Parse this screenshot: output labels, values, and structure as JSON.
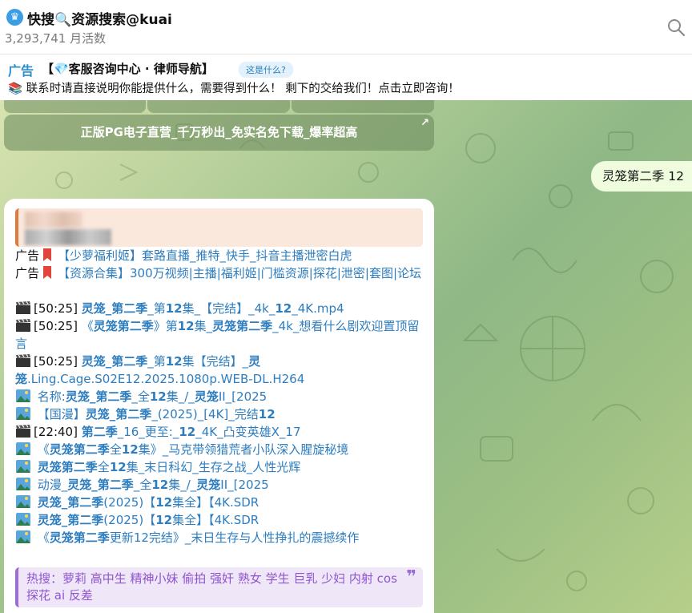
{
  "header": {
    "title": "快搜🔍资源搜索@kuai",
    "subtitle": "3,293,741 月活数"
  },
  "ad_bar": {
    "tag": "广告",
    "title": "【💎客服咨询中心 · 律师导航】",
    "whatis": "这是什么?",
    "description": "📚 联系时请直接说明你能提供什么，需要得到什么！ 剩下的交给我们！点击立即咨询！"
  },
  "keyboard": {
    "button_label": "正版PG电子直营_千万秒出_免实名免下载_爆率超高",
    "arrow": "↗"
  },
  "outgoing": {
    "text": "灵笼第二季 12"
  },
  "incoming": {
    "ad_label": "广告",
    "ad1": "【少萝福利姬】套路直播_推特_快手_抖音主播泄密白虎",
    "ad2": "【资源合集】300万视频|主播|福利姬|门槛资源|探花|泄密|套图|论坛",
    "results": [
      {
        "icon": "clapper-icon",
        "prefix": "[50:25] ",
        "parts": [
          [
            "灵笼_第二季",
            1
          ],
          [
            "_第",
            0
          ],
          [
            "12",
            1
          ],
          [
            "集_【完结】_4k_",
            0
          ],
          [
            "12",
            1
          ],
          [
            "_4K.mp4",
            0
          ]
        ]
      },
      {
        "icon": "clapper-icon",
        "prefix": "[50:25] ",
        "parts": [
          [
            "《",
            0
          ],
          [
            "灵笼第二季",
            1
          ],
          [
            "》第",
            0
          ],
          [
            "12",
            1
          ],
          [
            "集_",
            0
          ],
          [
            "灵笼第二季",
            1
          ],
          [
            "_4k_想看什么剧欢迎置顶留言",
            0
          ]
        ]
      },
      {
        "icon": "clapper-icon",
        "prefix": "[50:25] ",
        "parts": [
          [
            "灵笼_第二季",
            1
          ],
          [
            "_第",
            0
          ],
          [
            "12",
            1
          ],
          [
            "集【完结】_",
            0
          ],
          [
            "灵笼",
            1
          ],
          [
            ".Ling.Cage.S02E12.2025.1080p.WEB-DL.H264",
            0
          ]
        ]
      },
      {
        "icon": "picture-icon",
        "prefix": " ",
        "parts": [
          [
            "名称:",
            0
          ],
          [
            "灵笼_第二季",
            1
          ],
          [
            "_全",
            0
          ],
          [
            "12",
            1
          ],
          [
            "集_/_",
            0
          ],
          [
            "灵笼",
            1
          ],
          [
            "II_[2025",
            0
          ]
        ]
      },
      {
        "icon": "picture-icon",
        "prefix": " ",
        "parts": [
          [
            "【国漫】",
            0
          ],
          [
            "灵笼_第二季",
            1
          ],
          [
            "_(2025)_[4K]_完结",
            0
          ],
          [
            "12",
            1
          ]
        ]
      },
      {
        "icon": "clapper-icon",
        "prefix": "[22:40] ",
        "parts": [
          [
            "第二季",
            1
          ],
          [
            "_16_更至:_",
            0
          ],
          [
            "12",
            1
          ],
          [
            "_4K_凸变英雄X_17",
            0
          ]
        ]
      },
      {
        "icon": "picture-icon",
        "prefix": " ",
        "parts": [
          [
            "《",
            0
          ],
          [
            "灵笼第二季",
            1
          ],
          [
            "全",
            0
          ],
          [
            "12",
            1
          ],
          [
            "集》_马克带领猎荒者小队深入腥旋秘境",
            0
          ]
        ]
      },
      {
        "icon": "picture-icon",
        "prefix": " ",
        "parts": [
          [
            "灵笼第二季",
            1
          ],
          [
            "全",
            0
          ],
          [
            "12",
            1
          ],
          [
            "集_末日科幻_生存之战_人性光辉",
            0
          ]
        ]
      },
      {
        "icon": "picture-icon",
        "prefix": " ",
        "parts": [
          [
            "动漫_",
            0
          ],
          [
            "灵笼_第二季",
            1
          ],
          [
            "_全",
            0
          ],
          [
            "12",
            1
          ],
          [
            "集_/_",
            0
          ],
          [
            "灵笼",
            1
          ],
          [
            "II_[2025",
            0
          ]
        ]
      },
      {
        "icon": "picture-icon",
        "prefix": " ",
        "parts": [
          [
            "灵笼_第二季",
            1
          ],
          [
            "(2025)【",
            0
          ],
          [
            "12",
            1
          ],
          [
            "集全】【4K.SDR",
            0
          ]
        ]
      },
      {
        "icon": "picture-icon",
        "prefix": " ",
        "parts": [
          [
            "灵笼_第二季",
            1
          ],
          [
            "(2025)【",
            0
          ],
          [
            "12",
            1
          ],
          [
            "集全】【4K.SDR",
            0
          ]
        ]
      },
      {
        "icon": "picture-icon",
        "prefix": " ",
        "parts": [
          [
            "《",
            0
          ],
          [
            "灵笼第二季",
            1
          ],
          [
            "更新12完结》_末日生存与人性挣扎的震撼续作",
            0
          ]
        ]
      }
    ],
    "hot_search": "热搜：萝莉 高中生 精神小妹 偷拍 强奸 熟女 学生 巨乳 少妇 内射 cos 探花 ai 反差"
  },
  "colors": {
    "link": "#2d7dbf",
    "hot_text": "#8f55cf",
    "outgoing_bg": "#effdde",
    "accent_blue": "#3a9ee4"
  }
}
